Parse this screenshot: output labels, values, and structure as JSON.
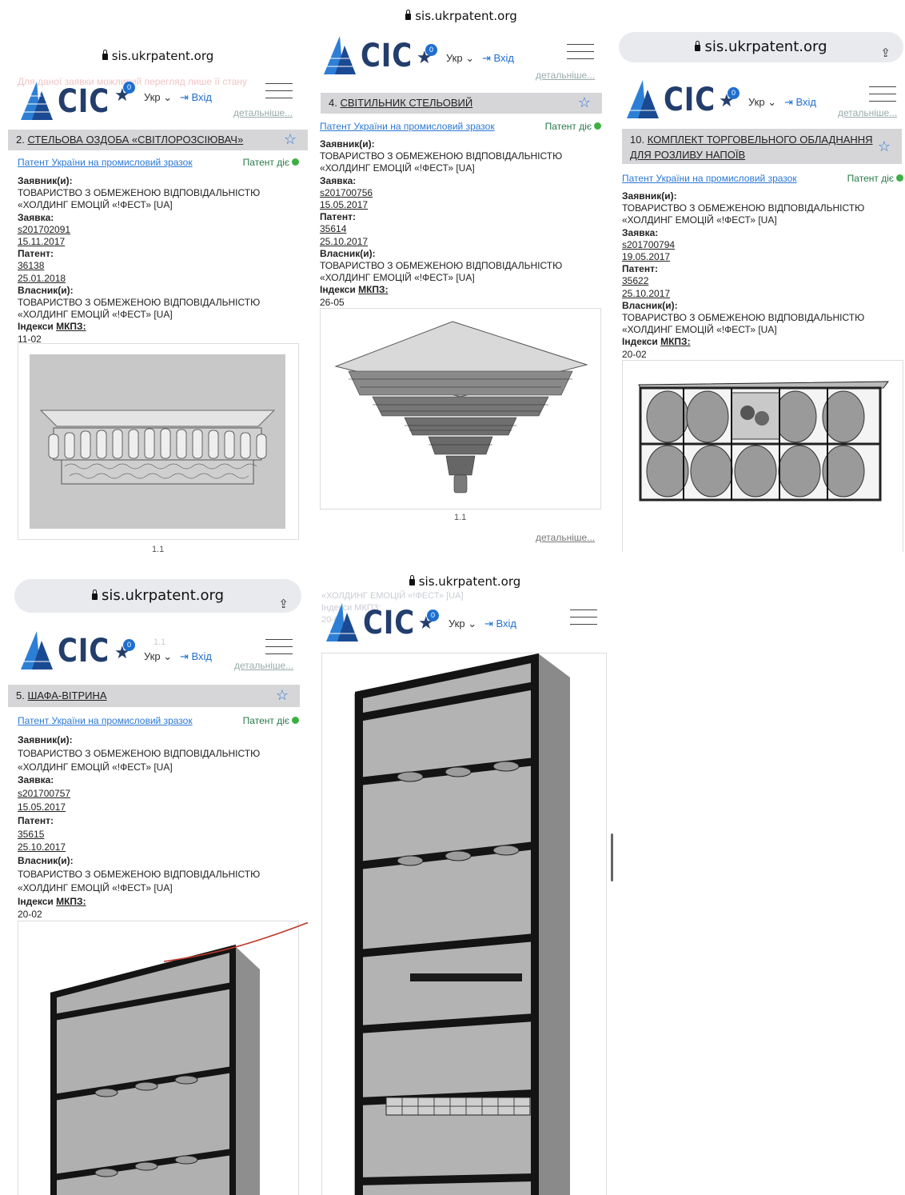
{
  "common": {
    "domain": "sis.ukrpatent.org",
    "logo_text": "CIC",
    "badge_count": "0",
    "lang": "Укр",
    "login": "Вхід",
    "more": "детальніше...",
    "patent_type": "Патент України на промисловий зразок",
    "status": "Патент діє",
    "applicant_label": "Заявник(и):",
    "applicant_l1": "ТОВАРИСТВО З ОБМЕЖЕНОЮ ВІДПОВІДАЛЬНІСТЮ",
    "applicant_l2": "«ХОЛДИНГ ЕМОЦІЙ «!ФЕСТ» [UA]",
    "application_label": "Заявка:",
    "patent_label": "Патент:",
    "owner_label": "Власник(и):",
    "mkpz_label_a": "Індекси ",
    "mkpz_label_b": "МКПЗ:",
    "caption": "1.1"
  },
  "panel1": {
    "faint_notice": "Для даної заявки можливий перегляд лише її стану",
    "num": "2.",
    "title": "СТЕЛЬОВА ОЗДОБА «СВІТЛОРОЗСІЮВАЧ»",
    "app_no": "s201702091",
    "app_date": "15.11.2017",
    "patent_no": "36138",
    "patent_date": "25.01.2018",
    "index": "11-02"
  },
  "panel2": {
    "num": "4.",
    "title": "СВІТИЛЬНИК СТЕЛЬОВИЙ",
    "app_no": "s201700756",
    "app_date": "15.05.2017",
    "patent_no": "35614",
    "patent_date": "25.10.2017",
    "index": "26-05"
  },
  "panel3": {
    "num": "10.",
    "title_l1": "КОМПЛЕКТ ТОРГОВЕЛЬНОГО ОБЛАДНАННЯ",
    "title_l2": "ДЛЯ РОЗЛИВУ НАПОЇВ",
    "app_no": "s201700794",
    "app_date": "19.05.2017",
    "patent_no": "35622",
    "patent_date": "25.10.2017",
    "index": "20-02"
  },
  "panel4": {
    "num": "5.",
    "title": "ШАФА-ВІТРИНА",
    "app_no": "s201700757",
    "app_date": "15.05.2017",
    "patent_no": "35615",
    "patent_date": "25.10.2017",
    "index": "20-02"
  },
  "panel5": {
    "faint_l1": "«ХОЛДИНГ ЕМОЦІЙ «!ФЕСТ» [UA]",
    "faint_l2": "Індекси МКПЗ:",
    "faint_l3": "20-02"
  }
}
